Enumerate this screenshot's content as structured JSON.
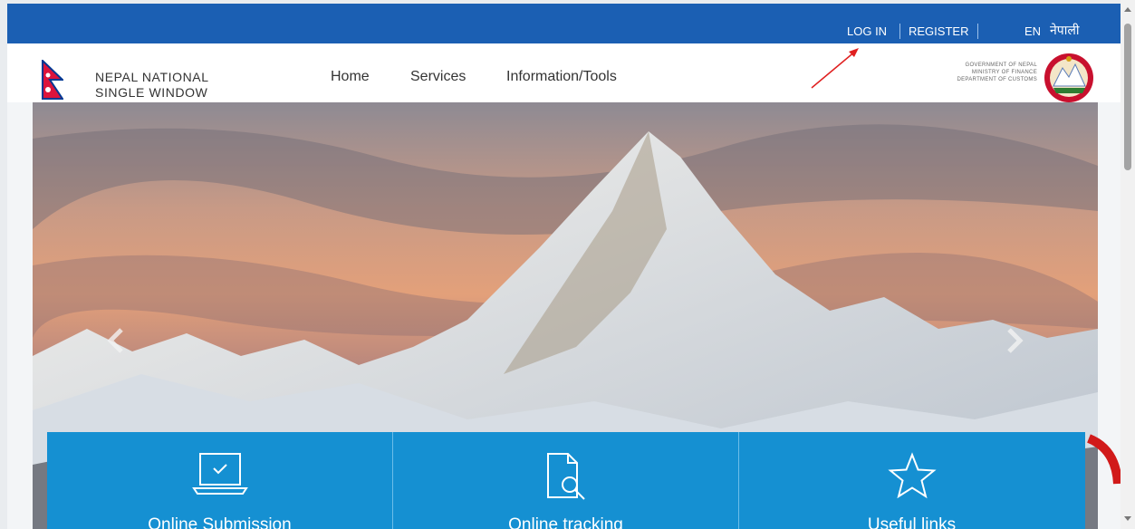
{
  "topbar": {
    "login": "LOG IN",
    "register": "REGISTER",
    "lang_en": "EN",
    "lang_np": "नेपाली"
  },
  "brand": {
    "line1": "NEPAL NATIONAL",
    "line2": "SINGLE WINDOW"
  },
  "nav": [
    "Home",
    "Services",
    "Information/Tools"
  ],
  "gov": {
    "line1": "GOVERNMENT OF NEPAL",
    "line2": "MINISTRY OF FINANCE",
    "line3": "DEPARTMENT OF CUSTOMS"
  },
  "cards": [
    {
      "label": "Online Submission",
      "icon": "laptop-check-icon"
    },
    {
      "label": "Online tracking",
      "icon": "document-search-icon"
    },
    {
      "label": "Useful links",
      "icon": "star-icon"
    }
  ],
  "colors": {
    "topbar": "#1b5fb3",
    "cards": "#1590d2",
    "annotation": "#e02020"
  }
}
